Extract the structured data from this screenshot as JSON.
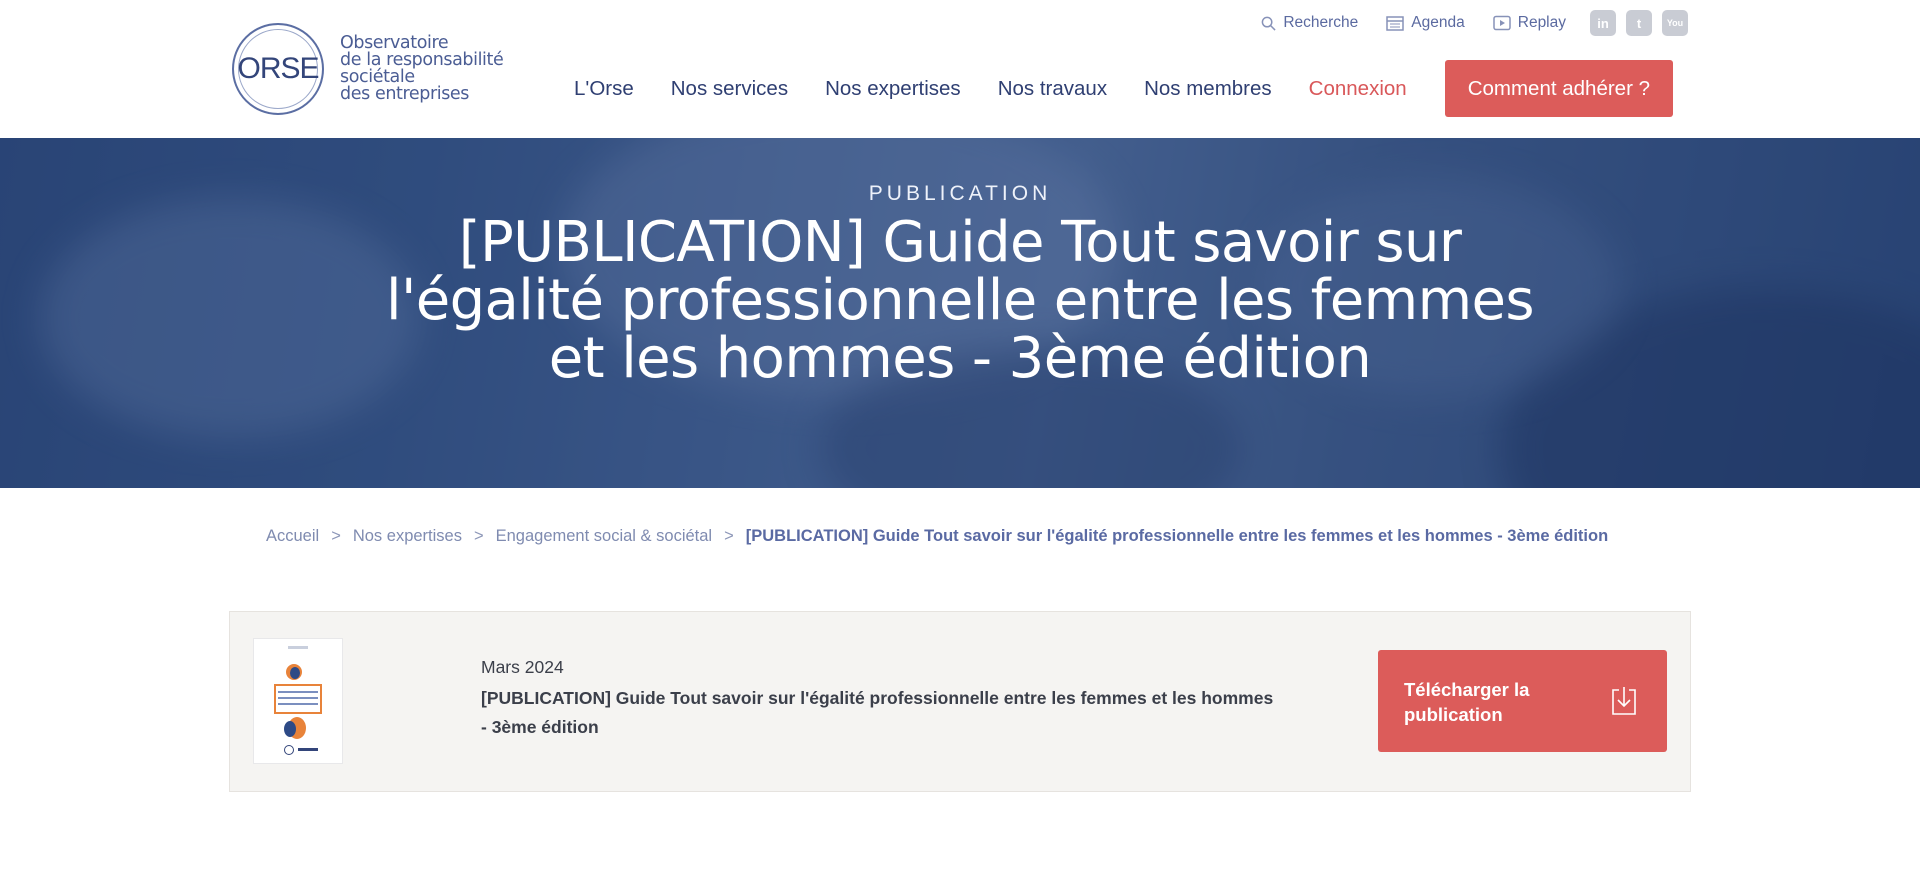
{
  "logo": {
    "mark": "ORSE",
    "lines": [
      "Observatoire",
      "de la responsabilité",
      "sociétale",
      "des entreprises"
    ]
  },
  "utility": {
    "search": "Recherche",
    "agenda": "Agenda",
    "replay": "Replay",
    "social": [
      {
        "icon": "linkedin-icon",
        "glyph": "in"
      },
      {
        "icon": "twitter-icon",
        "glyph": "t"
      },
      {
        "icon": "youtube-icon",
        "glyph": "You"
      }
    ]
  },
  "nav": {
    "items": [
      "L'Orse",
      "Nos services",
      "Nos expertises",
      "Nos travaux",
      "Nos membres"
    ],
    "login": "Connexion",
    "cta": "Comment adhérer ?"
  },
  "hero": {
    "kicker": "PUBLICATION",
    "title": "[PUBLICATION] Guide Tout savoir sur l'égalité professionnelle entre les femmes et les hommes - 3ème édition"
  },
  "breadcrumb": {
    "separator": ">",
    "items": [
      "Accueil",
      "Nos expertises",
      "Engagement social & sociétal"
    ],
    "current": "[PUBLICATION] Guide Tout savoir sur l'égalité professionnelle entre les femmes et les hommes - 3ème édition"
  },
  "publication": {
    "date": "Mars 2024",
    "title": "[PUBLICATION] Guide Tout savoir sur l'égalité professionnelle entre les femmes et les hommes - 3ème édition",
    "download_label": "Télécharger la publication"
  },
  "colors": {
    "accent": "#dc5c5a",
    "navy": "#2f3f72",
    "hero": "#3a5a8a"
  }
}
